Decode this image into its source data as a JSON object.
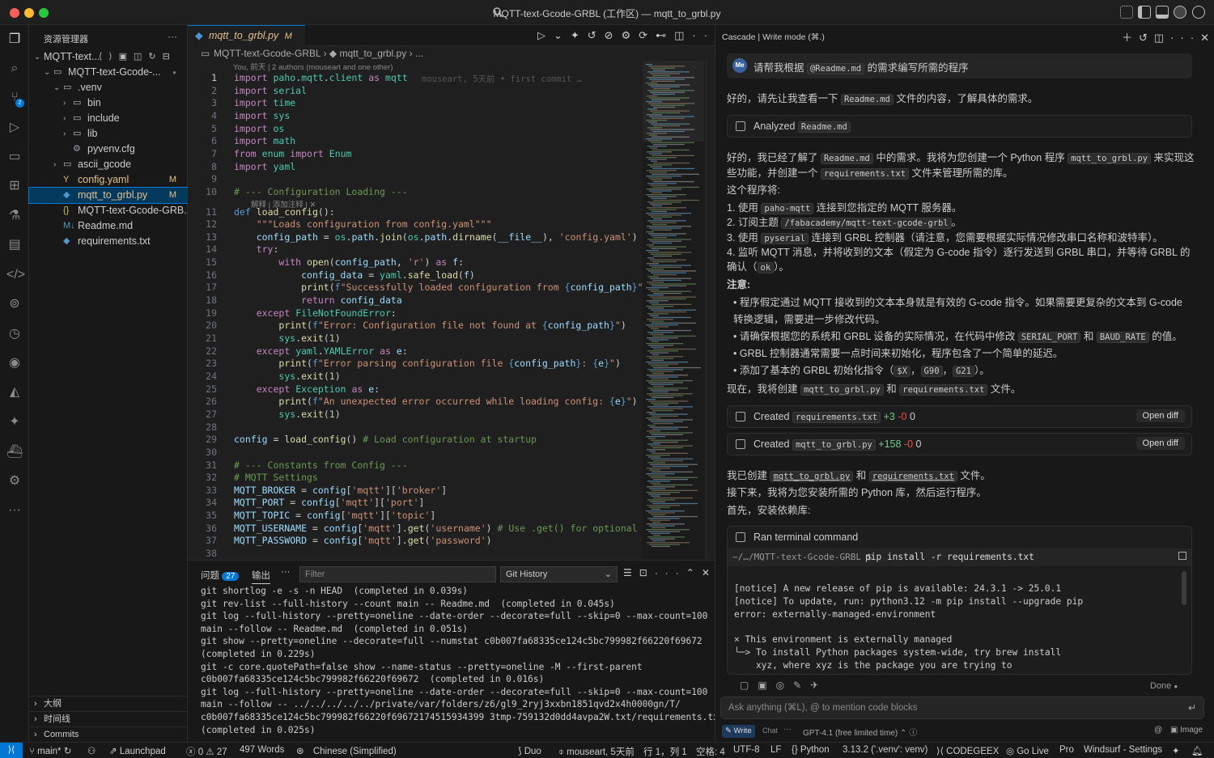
{
  "window": {
    "title": "MQTT-text-Gcode-GRBL (工作区) — mqtt_to_grbl.py"
  },
  "sidebar": {
    "title": "资源管理器",
    "more": "···",
    "workspace": "MQTT-text...",
    "tree": [
      {
        "label": "MQTT-text-Gcode-...",
        "chev": "⌄",
        "icon": "folder",
        "badge": "●"
      },
      {
        "label": ".venv",
        "chev": "⌄",
        "icon": "folder",
        "badge": ""
      },
      {
        "label": "bin",
        "chev": "›",
        "icon": "folder",
        "badge": ""
      },
      {
        "label": "include",
        "chev": "›",
        "icon": "folder",
        "badge": ""
      },
      {
        "label": "lib",
        "chev": "›",
        "icon": "folder",
        "badge": ""
      },
      {
        "label": "pyvenv.cfg",
        "chev": "",
        "icon": "gear",
        "badge": ""
      },
      {
        "label": "ascii_gcode",
        "chev": "›",
        "icon": "folder",
        "badge": ""
      },
      {
        "label": "config.yaml",
        "chev": "",
        "icon": "yaml",
        "badge": "M"
      },
      {
        "label": "mqtt_to_grbl.py",
        "chev": "",
        "icon": "python",
        "badge": "M"
      },
      {
        "label": "MQTT-text-Gcode-GRB...",
        "chev": "",
        "icon": "json",
        "badge": ""
      },
      {
        "label": "Readme.md",
        "chev": "",
        "icon": "markdown",
        "badge": ""
      },
      {
        "label": "requirements.txt",
        "chev": "",
        "icon": "python",
        "badge": ""
      }
    ],
    "sections": [
      "大纲",
      "时间线",
      "Commits"
    ]
  },
  "editor": {
    "tab": {
      "label": "mqtt_to_grbl.py",
      "badge": "M",
      "close": "✕"
    },
    "breadcrumb": [
      "MQTT-text-Gcode-GRBL",
      "mqtt_to_grbl.py",
      "..."
    ],
    "blame_header": "You, 前天 | 2 authors (mouseart and one other)",
    "inline_blame": "mouseart, 5天前 • first commit …",
    "codelens": "解释 | 添加注释 | ✕",
    "start_line": 1
  },
  "panel": {
    "tabs": [
      {
        "label": "问题",
        "count": "27"
      },
      {
        "label": "输出"
      }
    ],
    "more": "···",
    "filter_placeholder": "Filter",
    "output_channel": "Git History",
    "lines": [
      "git shortlog -e -s -n HEAD  (completed in 0.039s)",
      "git rev-list --full-history --count main -- Readme.md  (completed in 0.045s)",
      "git log --full-history --pretty=oneline --date-order --decorate=full --skip=0 --max-count=100",
      "main --follow -- Readme.md  (completed in 0.051s)",
      "git show --pretty=oneline --decorate=full --numstat c0b007fa68335ce124c5bc799982f66220f69672",
      "(completed in 0.229s)",
      "git -c core.quotePath=false show --name-status --pretty=oneline -M --first-parent",
      "c0b007fa68335ce124c5bc799982f66220f69672  (completed in 0.016s)",
      "git log --full-history --pretty=oneline --date-order --decorate=full --skip=0 --max-count=100",
      "main --follow -- ../../../../../private/var/folders/z6/gl9_2ryj3xxbn1851qvd2x4h0000gn/T/",
      "c0b007fa68335ce124c5bc799982f66220f69672174515934399 3tmp-759132d0dd4avpa2W.txt/requirements.txt",
      "(completed in 0.025s)"
    ]
  },
  "cascade": {
    "title": "Cascade | Write mode (⌘.)",
    "user_avatar": "Me",
    "user_msg": [
      "请帮我根据 ",
      "@Readme.md",
      " 的需求编写所需的程序"
    ],
    "p1": [
      "好的，请先让我查看一下 ",
      "Readme.md",
      " 文件的内容，了解具体的需求。"
    ],
    "analyzed": {
      "label": "Analyzed",
      "file": "Readme.md"
    },
    "p2a": [
      "好的，我已经了解了 ",
      "Readme.md",
      " 中的需求。我将为您创建一个 Python 程序 ",
      "mqtt_to_grbl.py",
      " 来实现这"
    ],
    "p2b": [
      "些功能，并创建一个 ",
      "requirements.txt",
      " 文件来管理所需的库。"
    ],
    "p3": "这个程序将:",
    "ol": [
      [
        "1.  使用 ",
        "paho-mqtt",
        " 连接到您指定的 MQTT 服务器。"
      ],
      [
        "2.  订阅主题 ",
        "/fabacademy/mqtt-text-gcode-grbl",
        "。"
      ],
      [
        "3.  使用 ",
        "pyserial",
        " 连接到 GRBL 控制器（请注意，您需要根据实际情况修改串口名称和波特率）。"
      ],
      [
        "4.  监听 MQTT 消息，并将收到的文本（假定为 G-code 指令）逐行发送到 GRBL 串口，并等待 GRBL 的"
      ],
      [
        "     确认（",
        "ok",
        "）。"
      ]
    ],
    "note_title": "注意:",
    "ul": [
      [
        "•  程序假定通过 MQTT 接收到的文本本身就是有效的 G-code 指令。如果需要更复杂的文本到 G-code"
      ],
      [
        "    转换逻辑，需要进一步修改代码。"
      ],
      [
        "•  请确保根据您的系统和 GRBL 设备的实际情况，在代码中修改 ",
        "SERIAL_PORT",
        " 和 ",
        "BAUD_RATE",
        " 的值。"
      ],
      [
        "•  GRBL 控制器通常需要一点时间来初始化，程序包含了一个简单的延迟。"
      ],
      [
        "•  添加了基本的 GRBL 初始化指令（",
        "$X",
        "，",
        "G90",
        "，",
        "G21",
        "）。"
      ]
    ],
    "p4": [
      "现在，我将创建 ",
      "mqtt_to_grbl.py",
      " 和 ",
      "requirements.txt",
      " 文件。"
    ],
    "created": [
      {
        "label": "Created",
        "file": "requirements.txt",
        "add": "+3",
        "del": "-0",
        "num": "0",
        "btn": "Open diff"
      },
      {
        "label": "Created",
        "file": "mqtt_to_grbl.py",
        "add": "+158",
        "del": "-0",
        "num": "0",
        "btn": "Open diff"
      }
    ],
    "p5": [
      "我已创建 ",
      "mqtt_to_grbl.py",
      " 和 ",
      "requirements.txt",
      " 文件。"
    ],
    "p6": "接下来，我将为您安装所需的 Python 库，然后运行程序。",
    "p7": "首先，安装依赖库:",
    "term": {
      "title": "Ran terminal command",
      "cwd": "~/…/MQTT-text-Gcode-GRBL $",
      "cmd": "pip install -r requirements.txt",
      "out": [
        "[notice] A new release of pip is available: 24.3.1 -> 25.0.1",
        "[notice] To update, run: python3.12 -m pip install --upgrade pip",
        "error: externally-managed-environment",
        "",
        "× This environment is externally managed",
        "╰─> To install Python packages system-wide, try brew install",
        "    xyz, where xyz is the package you are trying to"
      ]
    },
    "done": "Done",
    "ask_placeholder": "Ask anything (⌘L), @ to mention code blocks",
    "mode_write": "Write",
    "mode_chat": "Chat",
    "model": "GPT-4.1 (free limited time)",
    "image": "Image"
  },
  "statusbar": {
    "branch": "main*",
    "launchpad": "Launchpad",
    "errors": "0",
    "warnings": "27",
    "words": "497 Words",
    "lang_ext": "Chinese (Simplified)",
    "duo": "Duo",
    "blame": "mouseart, 5天前",
    "pos": "行 1，列 1",
    "spaces": "空格: 4",
    "encoding": "UTF-8",
    "eol": "LF",
    "lang": "Python",
    "pyver": "3.13.2 ('.venv': venv)",
    "codegeex": "CODEGEEX",
    "golive": "Go Live",
    "pro": "Pro",
    "settings": "Windsurf - Settings"
  },
  "colors": {
    "accent": "#0078d4",
    "modified": "#e2c08d",
    "added": "#73c991",
    "deleted": "#f14c4c"
  }
}
